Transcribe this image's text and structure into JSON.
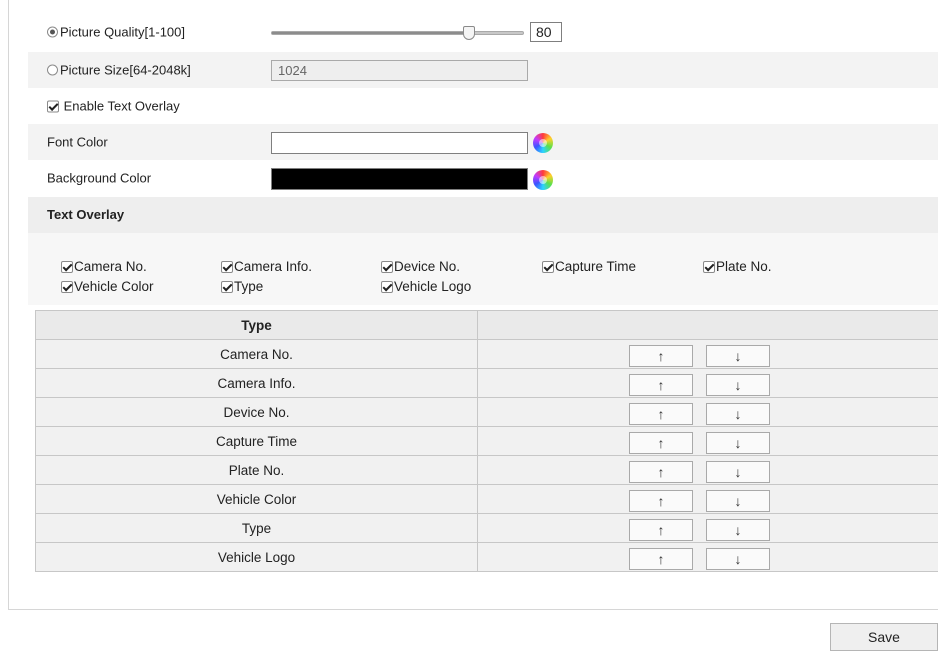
{
  "quality": {
    "label": "Picture Quality[1-100]",
    "value": "80",
    "slider_fraction": 0.78
  },
  "size": {
    "label": "Picture Size[64-2048k]",
    "value": "1024"
  },
  "overlay_toggle": {
    "label": "Enable Text Overlay",
    "checked": true
  },
  "font_color": {
    "label": "Font Color",
    "color": "#ffffff"
  },
  "bg_color": {
    "label": "Background Color",
    "color": "#000000"
  },
  "section": {
    "title": "Text Overlay"
  },
  "options": [
    {
      "label": "Camera No.",
      "checked": true
    },
    {
      "label": "Camera Info.",
      "checked": true
    },
    {
      "label": "Device No.",
      "checked": true
    },
    {
      "label": "Capture Time",
      "checked": true
    },
    {
      "label": "Plate No.",
      "checked": true
    },
    {
      "label": "Vehicle Color",
      "checked": true
    },
    {
      "label": "Type",
      "checked": true
    },
    {
      "label": "Vehicle Logo",
      "checked": true
    }
  ],
  "table": {
    "header_type": "Type",
    "header_order": "",
    "rows": [
      "Camera No.",
      "Camera Info.",
      "Device No.",
      "Capture Time",
      "Plate No.",
      "Vehicle Color",
      "Type",
      "Vehicle Logo"
    ],
    "up_label": "↑",
    "down_label": "↓"
  },
  "save_label": "Save"
}
